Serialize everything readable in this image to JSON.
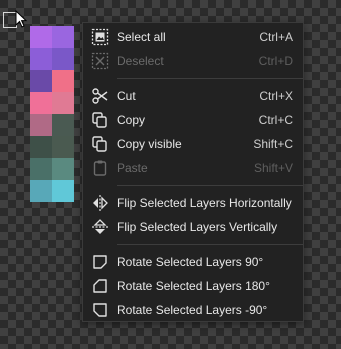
{
  "palette": [
    [
      "#b06ae8",
      "#9a66e0"
    ],
    [
      "#8c5ed8",
      "#7a58c8"
    ],
    [
      "#6a4aa8",
      "#f07088"
    ],
    [
      "#f07098",
      "#e07a94"
    ],
    [
      "#b06a86",
      "#4a5a52"
    ],
    [
      "#3e5048",
      "#4a5a50"
    ],
    [
      "#4a7068",
      "#5a8a80"
    ],
    [
      "#58a8b8",
      "#60c8d8"
    ]
  ],
  "menu": {
    "select_all": {
      "label": "Select all",
      "shortcut": "Ctrl+A"
    },
    "deselect": {
      "label": "Deselect",
      "shortcut": "Ctrl+D"
    },
    "cut": {
      "label": "Cut",
      "shortcut": "Ctrl+X"
    },
    "copy": {
      "label": "Copy",
      "shortcut": "Ctrl+C"
    },
    "copy_visible": {
      "label": "Copy visible",
      "shortcut": "Shift+C"
    },
    "paste": {
      "label": "Paste",
      "shortcut": "Shift+V"
    },
    "flip_h": {
      "label": "Flip Selected Layers Horizontally"
    },
    "flip_v": {
      "label": "Flip Selected Layers Vertically"
    },
    "rot90": {
      "label": "Rotate Selected Layers 90°"
    },
    "rot180": {
      "label": "Rotate Selected Layers 180°"
    },
    "rotm90": {
      "label": "Rotate Selected Layers -90°"
    }
  },
  "colors": {
    "menu_bg": "#222222",
    "text": "#e8e8e8",
    "disabled_text": "#6b6b6b"
  }
}
